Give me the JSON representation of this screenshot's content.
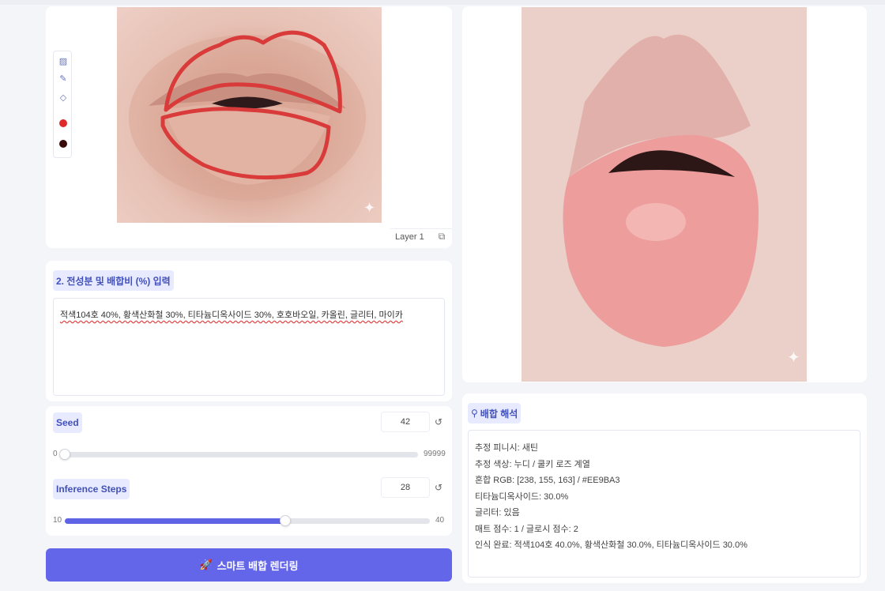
{
  "editor": {
    "layer_label": "Layer 1",
    "tools": [
      "image-icon",
      "brush-icon",
      "eraser-icon"
    ],
    "swatches": [
      {
        "name": "palette-icon",
        "color": "#e02929"
      },
      {
        "name": "color-dot",
        "color": "#3a0b0b"
      }
    ]
  },
  "ingredients": {
    "label": "2. 전성분 및 배합비 (%) 입력",
    "value": "적색104호 40%, 황색산화철 30%, 티타늄디옥사이드 30%, 호호바오일, 카올린, 글리터, 마이카"
  },
  "seed": {
    "label": "Seed",
    "value": "42",
    "min": "0",
    "max": "99999",
    "fraction": 0.0
  },
  "steps": {
    "label": "Inference Steps",
    "value": "28",
    "min": "10",
    "max": "40",
    "fraction": 0.6
  },
  "render_button": {
    "icon": "rocket-icon",
    "label": "스마트 배합 렌더링"
  },
  "analysis": {
    "title": "배합 해석",
    "lines": [
      "추정 피니시: 새틴",
      "추정 색상: 누디 / 쿨키 로즈 계열",
      "혼합 RGB: [238, 155, 163] / #EE9BA3",
      "티타늄디옥사이드: 30.0%",
      "글리터: 있음",
      "매트 점수: 1 / 글로시 점수: 2",
      "인식 완료: 적색104호 40.0%, 황색산화철 30.0%, 티타늄디옥사이드 30.0%"
    ]
  },
  "colors": {
    "accent": "#6466ea",
    "mask_stroke": "#d93a3a",
    "chip_bg": "#e8ebff"
  }
}
